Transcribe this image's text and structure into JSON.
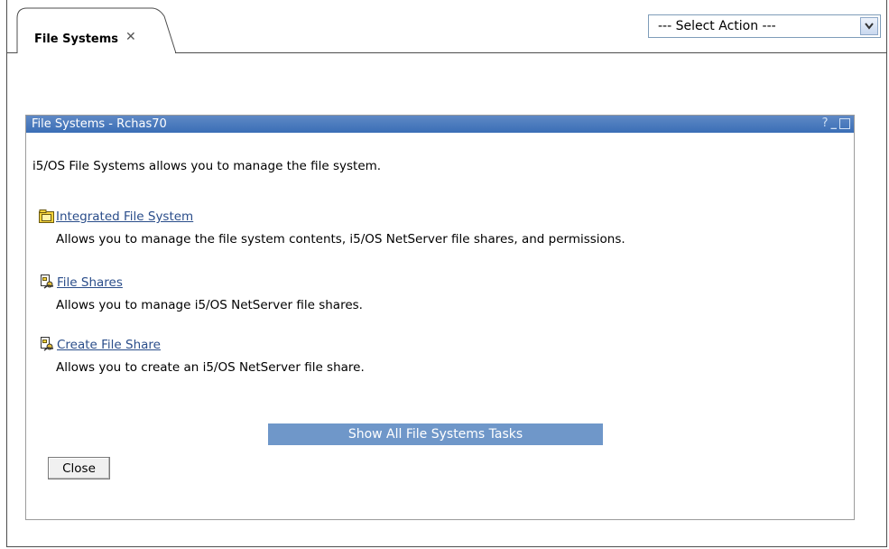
{
  "tab": {
    "label": "File Systems",
    "close_glyph": "✕"
  },
  "action_select": {
    "selected": "--- Select Action ---",
    "arrow_icon": "chevron-down-icon"
  },
  "portlet": {
    "title": "File Systems - Rchas70",
    "help_glyph": "?",
    "minimize_glyph": "_",
    "intro": "i5/OS File Systems allows you to manage the file system.",
    "tasks": [
      {
        "label": "Integrated File System",
        "icon": "folder-icon",
        "description": "Allows you to manage the file system contents, i5/OS NetServer file shares, and permissions."
      },
      {
        "label": "File Shares",
        "icon": "file-share-icon",
        "description": "Allows you to manage i5/OS NetServer file shares."
      },
      {
        "label": "Create File Share",
        "icon": "file-share-icon",
        "description": "Allows you to create an i5/OS NetServer file share."
      }
    ],
    "show_all_label": "Show All File Systems Tasks",
    "close_label": "Close"
  },
  "colors": {
    "titlebar": "#3a6eb6",
    "link": "#2a4d8a",
    "show_all_bg": "#6f97c9"
  }
}
